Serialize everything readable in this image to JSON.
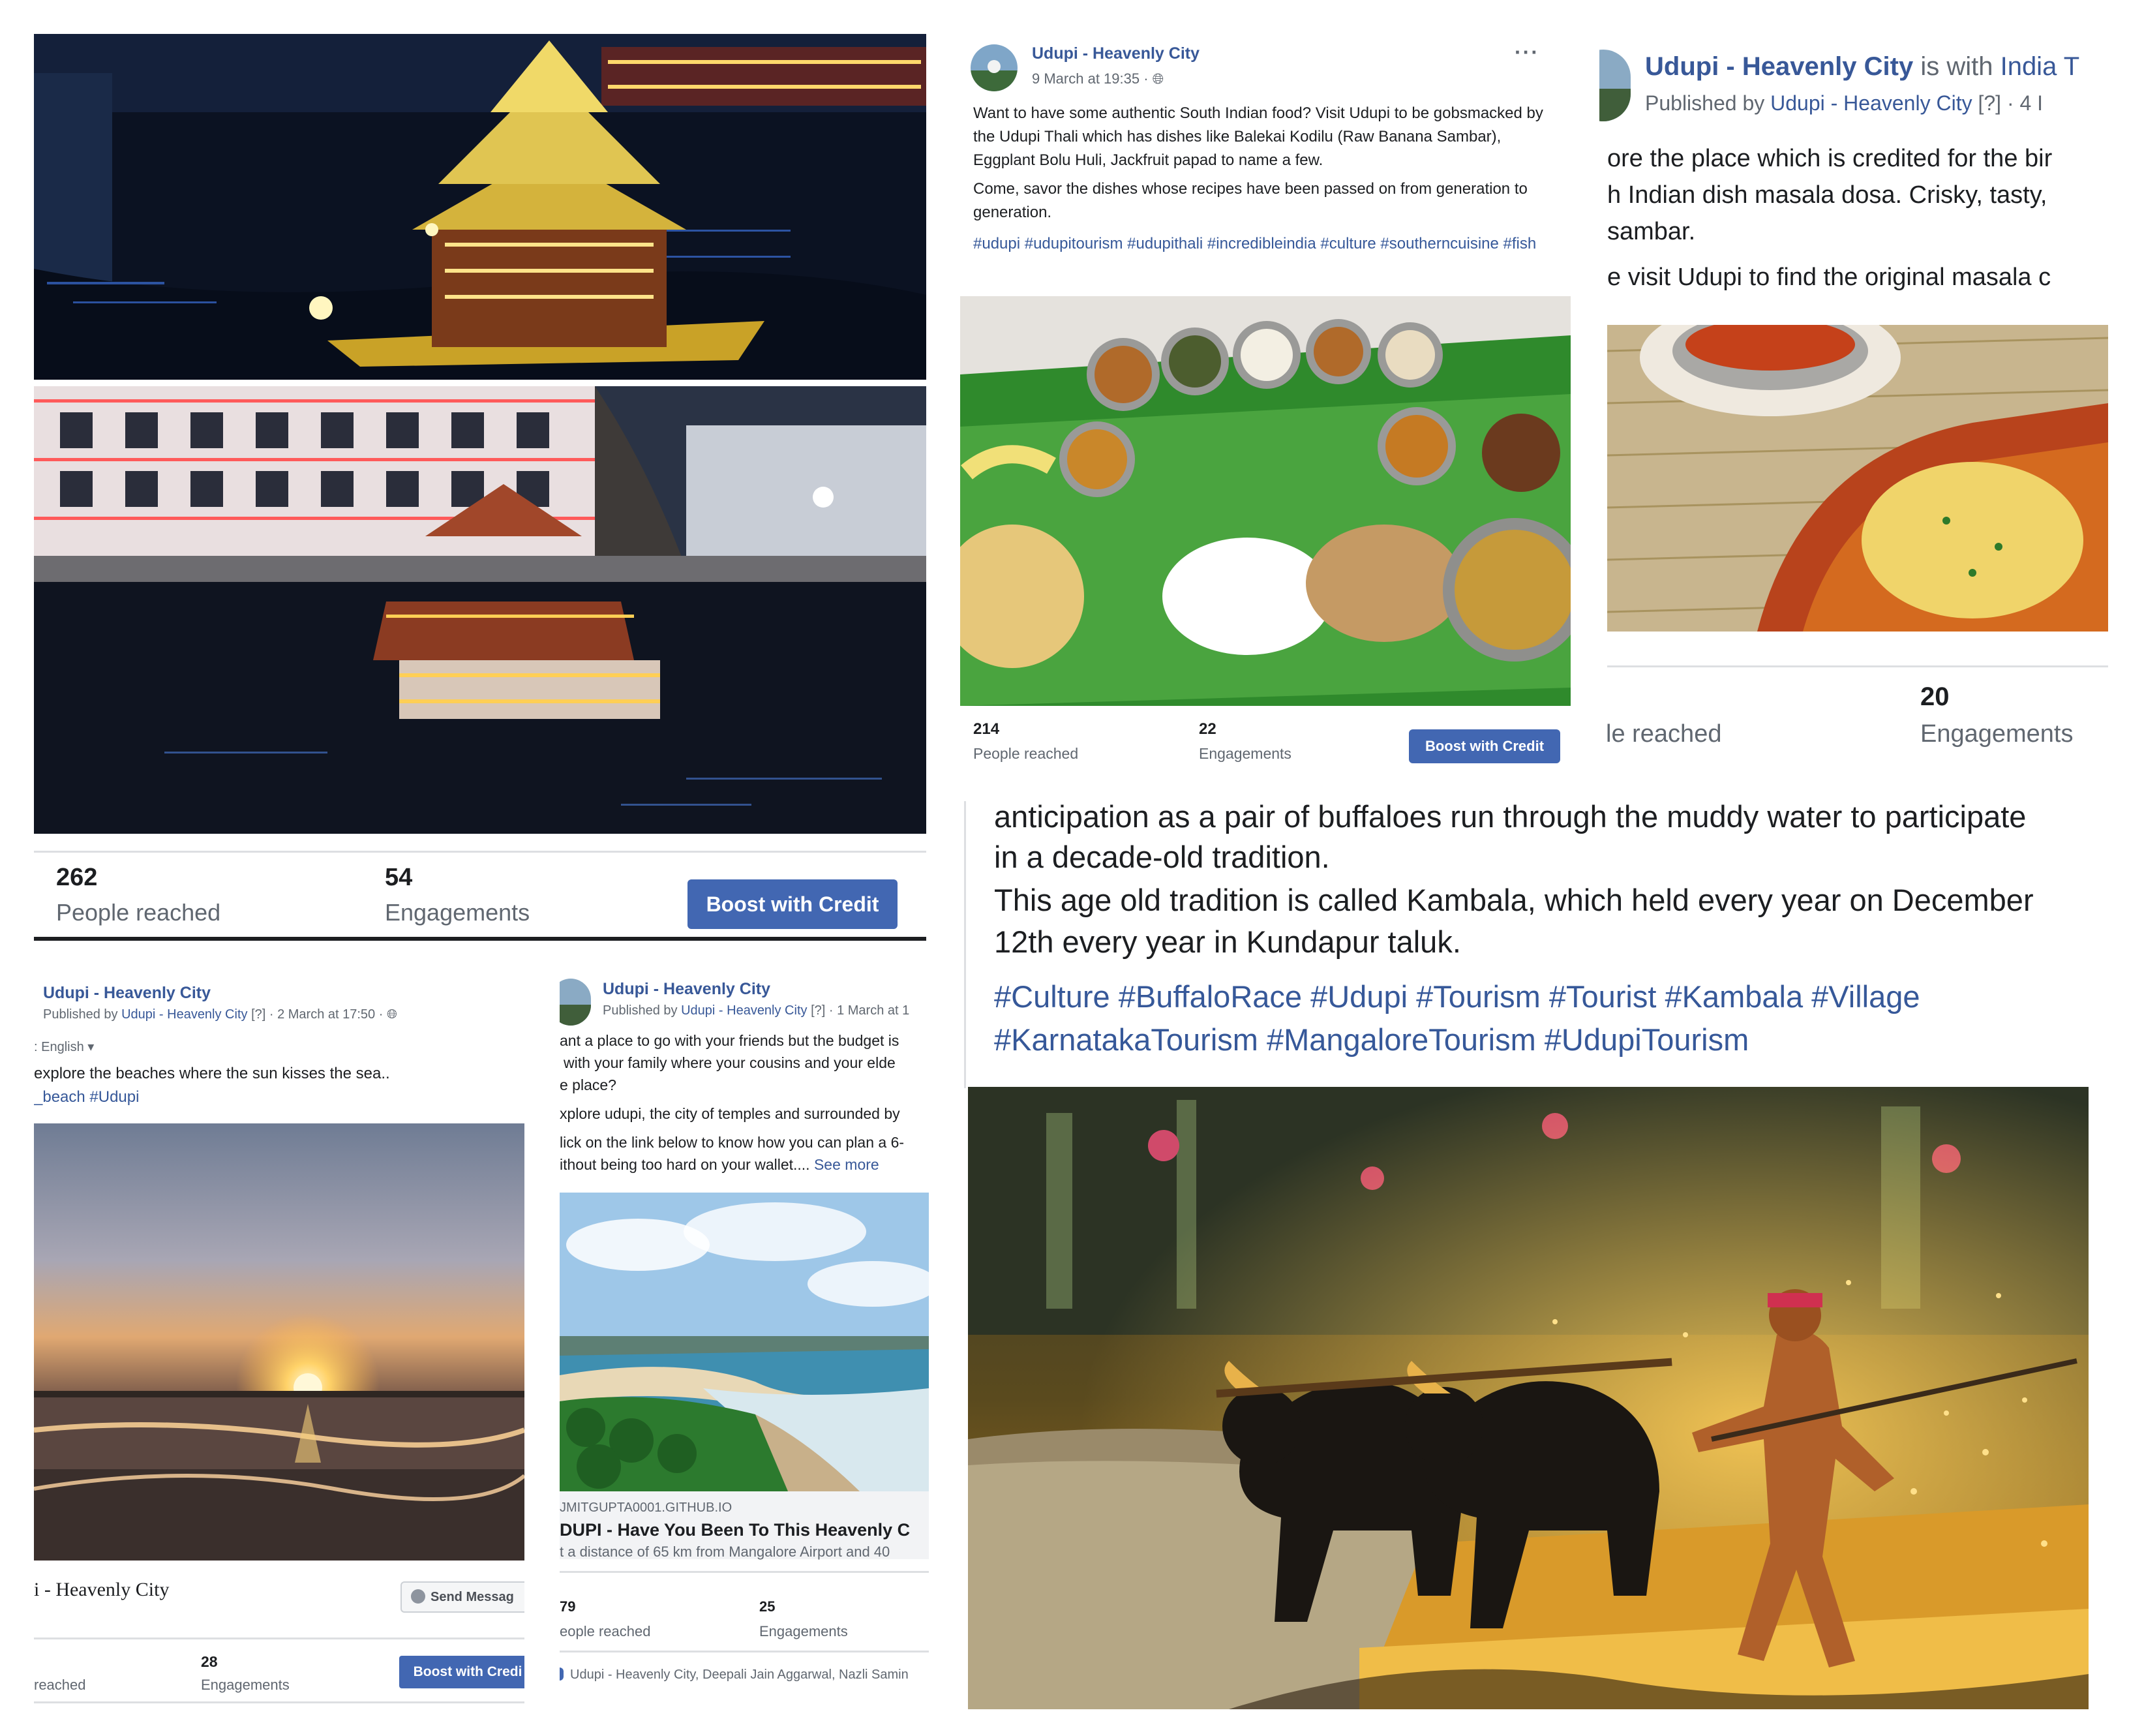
{
  "panel1": {
    "stats": {
      "reached_value": "262",
      "reached_label": "People reached",
      "eng_value": "54",
      "eng_label": "Engagements"
    },
    "boost_label": "Boost with Credit"
  },
  "panel2": {
    "page_name": "Udupi - Heavenly City",
    "time": "9 March at 19:35 ·",
    "p1": "Want to have some authentic South Indian food? Visit Udupi to be gobsmacked by the Udupi Thali which has dishes like Balekai Kodilu (Raw Banana Sambar), Eggplant Bolu Huli, Jackfruit papad to name a few.",
    "p2": "Come, savor the dishes whose recipes have been passed on from generation to generation.",
    "hashtags": "#udupi #udupitourism #udupithali #incredibleindia #culture #southerncuisine #fish",
    "stats": {
      "reached_value": "214",
      "reached_label": "People reached",
      "eng_value": "22",
      "eng_label": "Engagements"
    },
    "boost_label": "Boost with Credit",
    "more": "···"
  },
  "panel3": {
    "page_name": "Udupi - Heavenly City",
    "with_text": "is with India T",
    "published_by": "Published by",
    "publisher": "Udupi - Heavenly City",
    "meta_tail": "[?] · 4 I",
    "line1": "ore the place which is credited for the bir",
    "line2": "h Indian dish masala dosa. Crisky, tasty,",
    "line3": "sambar.",
    "line4": "e visit Udupi to find the original masala c",
    "stats": {
      "reached_label": "le reached",
      "eng_value": "20",
      "eng_label": "Engagements"
    }
  },
  "panel4": {
    "page_name": "Udupi - Heavenly City",
    "published_by": "Published by",
    "publisher": "Udupi - Heavenly City",
    "meta_tail": "[?] · 2 March at 17:50 ·",
    "language": ": English ▾",
    "text": "explore the beaches where the sun kisses the sea..",
    "hashtags": "_beach #Udupi",
    "page_footer": "i - Heavenly City",
    "send_label": "Send Messag",
    "stats": {
      "reached_label": "reached",
      "eng_value": "28",
      "eng_label": "Engagements"
    },
    "boost_label": "Boost with Credi"
  },
  "panel5": {
    "page_name": "Udupi - Heavenly City",
    "published_by": "Published by",
    "publisher": "Udupi - Heavenly City",
    "meta_tail": "[?] · 1 March at 1",
    "l1": "ant a place to go with your friends but the budget is",
    "l2": "with your family where your cousins and your elde",
    "l3": "e place?",
    "l4": "xplore udupi, the city of temples and surrounded by",
    "l5": "lick on the link below to know how you can plan a 6-",
    "l6": "ithout being too hard on your wallet....",
    "see_more": "See more",
    "link_domain": "JMITGUPTA0001.GITHUB.IO",
    "link_title": "DUPI - Have You Been To This Heavenly C",
    "link_desc": "t a distance of 65 km from Mangalore Airport and 40",
    "stats": {
      "reached_value": "79",
      "reached_label": "eople reached",
      "eng_value": "25",
      "eng_label": "Engagements"
    },
    "tagged": "Udupi - Heavenly City, Deepali Jain Aggarwal, Nazli Samin"
  },
  "panel6": {
    "l1": "anticipation as a pair of buffaloes run through the muddy water to participate",
    "l2": "in a decade-old tradition.",
    "l3": "This age old tradition is called Kambala, which held every year on December",
    "l4": "12th every year in Kundapur taluk.",
    "hashtags1": "#Culture #BuffaloRace #Udupi #Tourism #Tourist #Kambala #Village",
    "hashtags2": "#KarnatakaTourism #MangaloreTourism #UdupiTourism"
  },
  "colors": {
    "link": "#385898",
    "boost": "#4267b2",
    "grey": "#606770"
  }
}
